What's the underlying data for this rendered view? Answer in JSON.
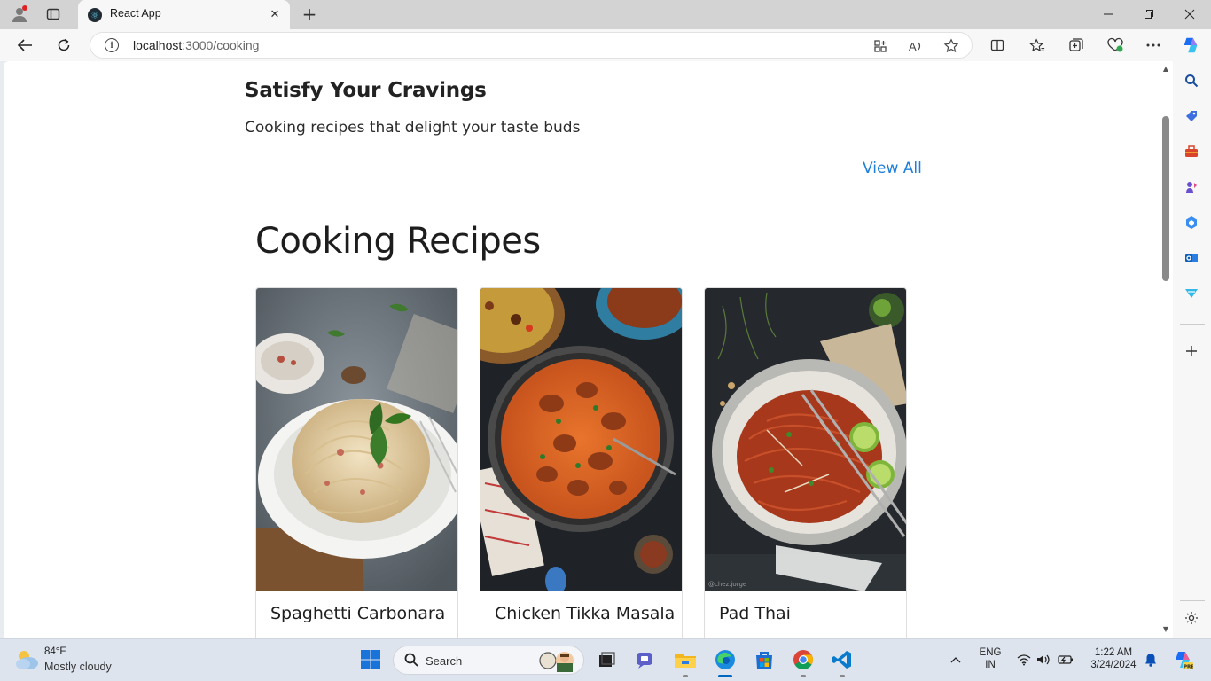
{
  "browser": {
    "tab_title": "React App",
    "url_host": "localhost",
    "url_rest": ":3000/cooking"
  },
  "page": {
    "hero_title": "Satisfy Your Cravings",
    "hero_subtitle": "Cooking recipes that delight your taste buds",
    "view_all": "View All",
    "section_title": "Cooking Recipes",
    "recipes": [
      {
        "title": "Spaghetti Carbonara"
      },
      {
        "title": "Chicken Tikka Masala"
      },
      {
        "title": "Pad Thai",
        "watermark": "@chez.jorge"
      }
    ]
  },
  "taskbar": {
    "weather_temp": "84°F",
    "weather_desc": "Mostly cloudy",
    "search_placeholder": "Search",
    "lang_line1": "ENG",
    "lang_line2": "IN",
    "time": "1:22 AM",
    "date": "3/24/2024"
  },
  "colors": {
    "link": "#1e7fd8",
    "accent": "#0067c0"
  }
}
